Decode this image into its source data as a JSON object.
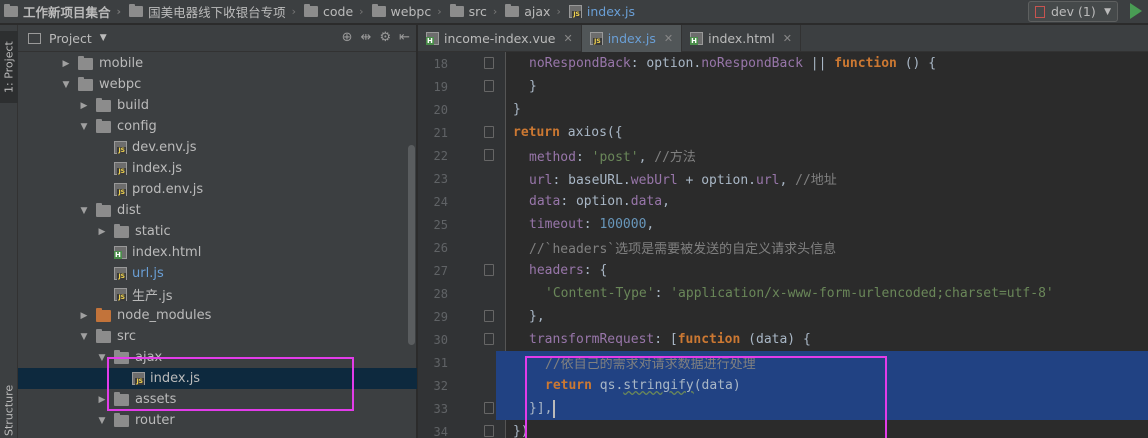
{
  "breadcrumbs": [
    "工作新项目集合",
    "国美电器线下收银台专项",
    "code",
    "webpc",
    "src",
    "ajax",
    "index.js"
  ],
  "run_config": {
    "label": "dev (1)"
  },
  "toolwindow": {
    "project_tab": "1: Project",
    "structure_tab": "Structure"
  },
  "project_panel": {
    "title": "Project",
    "tree": [
      {
        "label": "mobile",
        "type": "folder",
        "expanded": false,
        "depth": 3
      },
      {
        "label": "webpc",
        "type": "folder",
        "expanded": true,
        "depth": 3
      },
      {
        "label": "build",
        "type": "folder",
        "expanded": false,
        "depth": 4
      },
      {
        "label": "config",
        "type": "folder",
        "expanded": true,
        "depth": 4
      },
      {
        "label": "dev.env.js",
        "type": "js",
        "depth": 5
      },
      {
        "label": "index.js",
        "type": "js",
        "depth": 5
      },
      {
        "label": "prod.env.js",
        "type": "js",
        "depth": 5
      },
      {
        "label": "dist",
        "type": "folder",
        "expanded": true,
        "depth": 4
      },
      {
        "label": "static",
        "type": "folder",
        "expanded": false,
        "depth": 5
      },
      {
        "label": "index.html",
        "type": "html",
        "depth": 5
      },
      {
        "label": "url.js",
        "type": "js",
        "depth": 5,
        "blue": true
      },
      {
        "label": "生产.js",
        "type": "js",
        "depth": 5
      },
      {
        "label": "node_modules",
        "type": "folder-orange",
        "expanded": false,
        "depth": 4
      },
      {
        "label": "src",
        "type": "folder",
        "expanded": true,
        "depth": 4
      },
      {
        "label": "ajax",
        "type": "folder",
        "expanded": true,
        "depth": 5
      },
      {
        "label": "index.js",
        "type": "js",
        "depth": 6,
        "selected": true
      },
      {
        "label": "assets",
        "type": "folder",
        "expanded": false,
        "depth": 5
      },
      {
        "label": "router",
        "type": "folder",
        "expanded": true,
        "depth": 5
      }
    ]
  },
  "editor": {
    "tabs": [
      {
        "label": "income-index.vue",
        "icon": "vue",
        "active": false
      },
      {
        "label": "index.js",
        "icon": "js",
        "active": true
      },
      {
        "label": "index.html",
        "icon": "html",
        "active": false
      }
    ],
    "lines": [
      {
        "n": "18",
        "indent": 2,
        "tokens": [
          [
            "prop",
            "noRespondBack"
          ],
          [
            "plain",
            ": option."
          ],
          [
            "prop",
            "noRespondBack"
          ],
          [
            "plain",
            " || "
          ],
          [
            "kw",
            "function"
          ],
          [
            "plain",
            " () {"
          ]
        ]
      },
      {
        "n": "19",
        "indent": 2,
        "tokens": [
          [
            "plain",
            "}"
          ]
        ]
      },
      {
        "n": "20",
        "indent": 1,
        "tokens": [
          [
            "plain",
            "}"
          ]
        ]
      },
      {
        "n": "21",
        "indent": 1,
        "tokens": [
          [
            "kw",
            "return"
          ],
          [
            "plain",
            " axios({"
          ]
        ]
      },
      {
        "n": "22",
        "indent": 2,
        "tokens": [
          [
            "prop",
            "method"
          ],
          [
            "plain",
            ": "
          ],
          [
            "str",
            "'post'"
          ],
          [
            "plain",
            ", "
          ],
          [
            "cmt",
            "//方法"
          ]
        ]
      },
      {
        "n": "23",
        "indent": 2,
        "tokens": [
          [
            "prop",
            "url"
          ],
          [
            "plain",
            ": baseURL."
          ],
          [
            "prop",
            "webUrl"
          ],
          [
            "plain",
            " + option."
          ],
          [
            "prop",
            "url"
          ],
          [
            "plain",
            ", "
          ],
          [
            "cmt",
            "//地址"
          ]
        ]
      },
      {
        "n": "24",
        "indent": 2,
        "tokens": [
          [
            "prop",
            "data"
          ],
          [
            "plain",
            ": option."
          ],
          [
            "prop",
            "data"
          ],
          [
            "plain",
            ","
          ]
        ]
      },
      {
        "n": "25",
        "indent": 2,
        "tokens": [
          [
            "prop",
            "timeout"
          ],
          [
            "plain",
            ": "
          ],
          [
            "num",
            "100000"
          ],
          [
            "plain",
            ","
          ]
        ]
      },
      {
        "n": "26",
        "indent": 2,
        "tokens": [
          [
            "cmt",
            "//`headers`选项是需要被发送的自定义请求头信息"
          ]
        ]
      },
      {
        "n": "27",
        "indent": 2,
        "tokens": [
          [
            "prop",
            "headers"
          ],
          [
            "plain",
            ": {"
          ]
        ]
      },
      {
        "n": "28",
        "indent": 3,
        "tokens": [
          [
            "str",
            "'Content-Type'"
          ],
          [
            "plain",
            ": "
          ],
          [
            "str",
            "'application/x-www-form-urlencoded;charset=utf-8'"
          ]
        ]
      },
      {
        "n": "29",
        "indent": 2,
        "tokens": [
          [
            "plain",
            "},"
          ]
        ]
      },
      {
        "n": "30",
        "indent": 2,
        "tokens": [
          [
            "prop",
            "transformRequest"
          ],
          [
            "plain",
            ": ["
          ],
          [
            "kw",
            "function"
          ],
          [
            "plain",
            " (data) {"
          ]
        ]
      },
      {
        "n": "31",
        "indent": 3,
        "tokens": [
          [
            "cmt",
            "//依自己的需求对请求数据进行处理"
          ]
        ]
      },
      {
        "n": "32",
        "indent": 3,
        "tokens": [
          [
            "kw",
            "return"
          ],
          [
            "plain",
            " qs."
          ],
          [
            "wavy",
            "stringify"
          ],
          [
            "plain",
            "(data)"
          ]
        ]
      },
      {
        "n": "33",
        "indent": 2,
        "tokens": [
          [
            "plain",
            "}],"
          ]
        ]
      },
      {
        "n": "34",
        "indent": 1,
        "tokens": [
          [
            "plain",
            "})"
          ]
        ]
      }
    ]
  }
}
